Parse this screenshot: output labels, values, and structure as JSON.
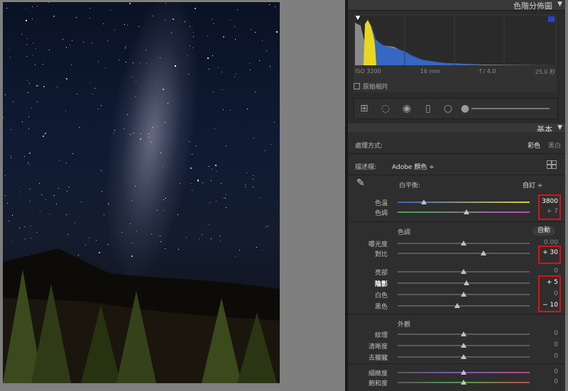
{
  "histogram": {
    "title": "色階分佈圖",
    "iso": "ISO 3200",
    "focal": "16 mm",
    "aperture": "f / 4.0",
    "shutter": "25.0 秒",
    "original_photo_label": "原始相片"
  },
  "basic": {
    "title": "基本",
    "treatment_label": "處理方式:",
    "treatment_color": "彩色",
    "treatment_bw": "黑白",
    "profile_label": "描述檔:",
    "profile_value": "Adobe 顏色 ÷",
    "wb_label": "白平衡:",
    "wb_value": "自訂 ÷",
    "tone_label": "色調",
    "auto_label": "自動",
    "presence_label": "外觀",
    "sliders": [
      {
        "id": "temp",
        "label": "色溫",
        "value": "3800",
        "pos": 0.2,
        "highlight": true,
        "bold": false
      },
      {
        "id": "tint",
        "label": "色調",
        "value": "+ 7",
        "pos": 0.52,
        "highlight": false,
        "bold": false
      },
      {
        "id": "exposure",
        "label": "曝光度",
        "value": "0.00",
        "pos": 0.5,
        "highlight": false,
        "bold": false
      },
      {
        "id": "contrast",
        "label": "對比",
        "value": "+ 30",
        "pos": 0.65,
        "highlight": true,
        "bold": false
      },
      {
        "id": "highlights",
        "label": "亮部",
        "value": "0",
        "pos": 0.5,
        "highlight": false,
        "bold": false
      },
      {
        "id": "shadows",
        "label": "陰影",
        "value": "+ 5",
        "pos": 0.52,
        "highlight": true,
        "bold": true
      },
      {
        "id": "whites",
        "label": "白色",
        "value": "0",
        "pos": 0.5,
        "highlight": false,
        "bold": false
      },
      {
        "id": "blacks",
        "label": "黑色",
        "value": "− 10",
        "pos": 0.45,
        "highlight": true,
        "bold": false
      },
      {
        "id": "texture",
        "label": "紋理",
        "value": "0",
        "pos": 0.5,
        "highlight": false,
        "bold": false
      },
      {
        "id": "clarity",
        "label": "清晰度",
        "value": "0",
        "pos": 0.5,
        "highlight": false,
        "bold": false
      },
      {
        "id": "dehaze",
        "label": "去朦朧",
        "value": "0",
        "pos": 0.5,
        "highlight": false,
        "bold": false
      },
      {
        "id": "vibrance",
        "label": "細緻度",
        "value": "0",
        "pos": 0.5,
        "highlight": false,
        "bold": false
      },
      {
        "id": "saturation",
        "label": "飽和度",
        "value": "0",
        "pos": 0.5,
        "highlight": false,
        "bold": false
      }
    ]
  }
}
